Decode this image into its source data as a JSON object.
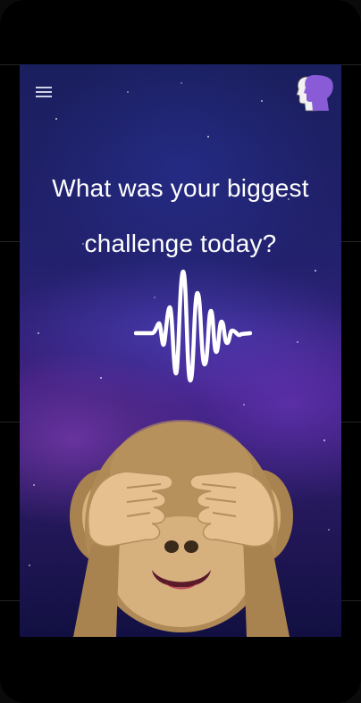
{
  "prompt": {
    "line1": "What was your biggest",
    "line2": "challenge today?"
  },
  "icons": {
    "menu": "hamburger-menu-icon",
    "profile": "head-silhouette-icon",
    "record": "sound-wave-icon",
    "emoji": "see-no-evil-monkey-emoji"
  },
  "colors": {
    "background_top": "#1a1f5e",
    "background_mid": "#3a1f7a",
    "profile_purple": "#8a5bd6",
    "text": "#ffffff"
  }
}
